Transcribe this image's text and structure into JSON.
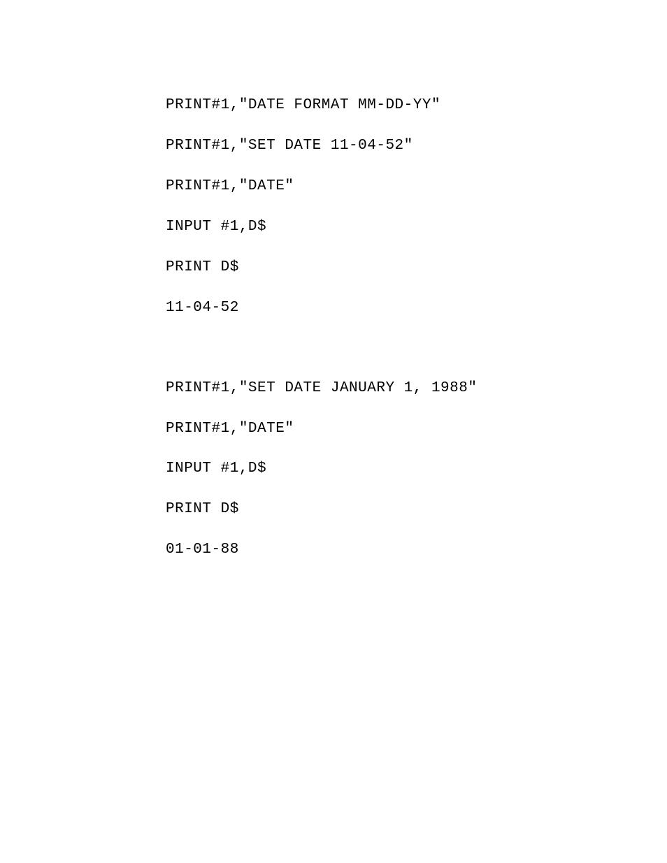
{
  "block1": {
    "line1": "PRINT#1,\"DATE FORMAT MM-DD-YY\"",
    "line2": "PRINT#1,\"SET DATE 11-04-52\"",
    "line3": "PRINT#1,\"DATE\"",
    "line4": "INPUT #1,D$",
    "line5": "PRINT D$",
    "line6": "11-04-52"
  },
  "block2": {
    "line1": "PRINT#1,\"SET DATE JANUARY 1, 1988\"",
    "line2": "PRINT#1,\"DATE\"",
    "line3": "INPUT #1,D$",
    "line4": "PRINT D$",
    "line5": "01-01-88"
  }
}
